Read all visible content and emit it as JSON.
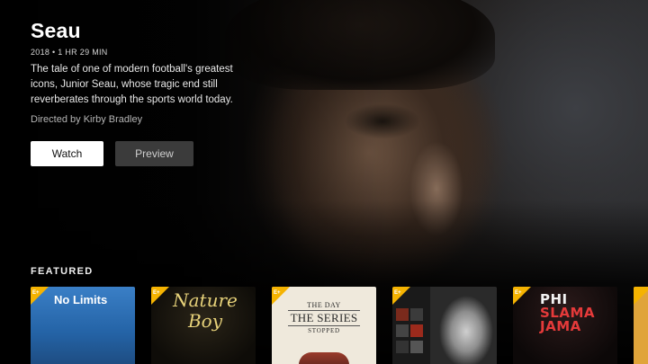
{
  "hero": {
    "title": "Seau",
    "meta": "2018 • 1 HR 29 MIN",
    "description": "The tale of one of modern football's greatest icons, Junior Seau, whose tragic end still reverberates through the sports world today.",
    "director": "Directed by Kirby Bradley",
    "watch_label": "Watch",
    "preview_label": "Preview"
  },
  "featured": {
    "label": "FEATURED",
    "items": [
      {
        "title": "No Limits"
      },
      {
        "title": "Nature Boy"
      },
      {
        "title_line1": "THE DAY",
        "title_line2": "THE SERIES",
        "title_line3": "STOPPED"
      },
      {
        "title": ""
      },
      {
        "title_line1": "PHI",
        "title_line2": "SLAMA",
        "title_line3": "JAMA"
      },
      {
        "title": ""
      }
    ]
  },
  "colors": {
    "badge": "#f5b301",
    "watch_bg": "#ffffff",
    "preview_bg": "#3b3b3b"
  },
  "icons": {
    "badge": "espn-plus-badge-icon"
  }
}
